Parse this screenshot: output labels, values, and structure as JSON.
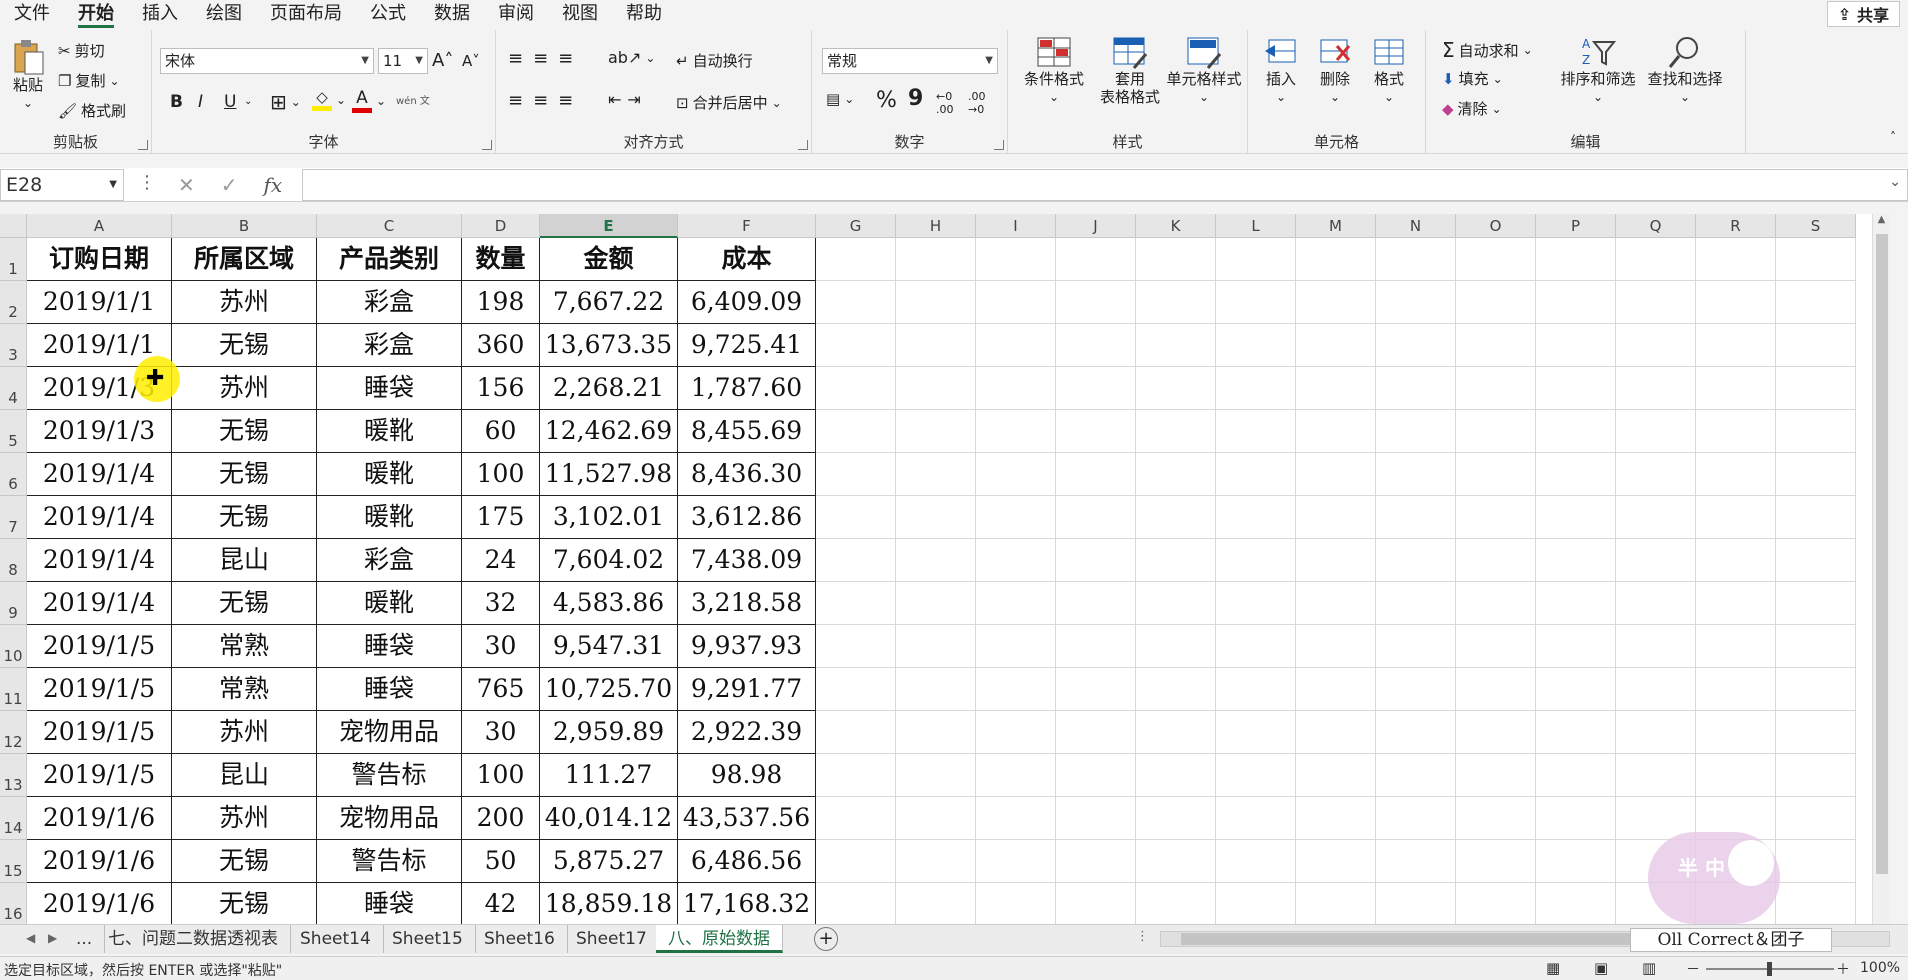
{
  "menu": {
    "items": [
      "文件",
      "开始",
      "插入",
      "绘图",
      "页面布局",
      "公式",
      "数据",
      "审阅",
      "视图",
      "帮助"
    ],
    "active": "开始",
    "share_label": "共享"
  },
  "ribbon": {
    "clipboard": {
      "paste": "粘贴",
      "cut": "剪切",
      "copy": "复制",
      "format_painter": "格式刷",
      "label": "剪贴板"
    },
    "font": {
      "name": "宋体",
      "size": "11",
      "label": "字体",
      "bold": "B",
      "italic": "I",
      "underline": "U",
      "wen": "wén 文"
    },
    "alignment": {
      "wrap": "自动换行",
      "merge": "合并后居中",
      "label": "对齐方式"
    },
    "number": {
      "format": "常规",
      "label": "数字",
      "percent": "%",
      "comma": "9"
    },
    "styles": {
      "conditional": "条件格式",
      "table_1": "套用",
      "table_2": "表格格式",
      "cell_styles": "单元格样式",
      "label": "样式"
    },
    "cells": {
      "insert": "插入",
      "delete": "删除",
      "format": "格式",
      "label": "单元格"
    },
    "editing": {
      "autosum": "自动求和",
      "fill": "填充",
      "clear": "清除",
      "sort": "排序和筛选",
      "find": "查找和选择",
      "label": "编辑"
    }
  },
  "formula_bar": {
    "name_box": "E28",
    "fx": "fx",
    "value": ""
  },
  "grid": {
    "columns": [
      "A",
      "B",
      "C",
      "D",
      "E",
      "F",
      "G",
      "H",
      "I",
      "J",
      "K",
      "L",
      "M",
      "N",
      "O",
      "P",
      "Q",
      "R",
      "S"
    ],
    "selected_column": "E",
    "rows": [
      "1",
      "2",
      "3",
      "4",
      "5",
      "6",
      "7",
      "8",
      "9",
      "10",
      "11",
      "12",
      "13",
      "14",
      "15",
      "16"
    ],
    "header": [
      "订购日期",
      "所属区域",
      "产品类别",
      "数量",
      "金额",
      "成本"
    ],
    "data": [
      [
        "2019/1/1",
        "苏州",
        "彩盒",
        "198",
        "7,667.22",
        "6,409.09"
      ],
      [
        "2019/1/1",
        "无锡",
        "彩盒",
        "360",
        "13,673.35",
        "9,725.41"
      ],
      [
        "2019/1/3",
        "苏州",
        "睡袋",
        "156",
        "2,268.21",
        "1,787.60"
      ],
      [
        "2019/1/3",
        "无锡",
        "暖靴",
        "60",
        "12,462.69",
        "8,455.69"
      ],
      [
        "2019/1/4",
        "无锡",
        "暖靴",
        "100",
        "11,527.98",
        "8,436.30"
      ],
      [
        "2019/1/4",
        "无锡",
        "暖靴",
        "175",
        "3,102.01",
        "3,612.86"
      ],
      [
        "2019/1/4",
        "昆山",
        "彩盒",
        "24",
        "7,604.02",
        "7,438.09"
      ],
      [
        "2019/1/4",
        "无锡",
        "暖靴",
        "32",
        "4,583.86",
        "3,218.58"
      ],
      [
        "2019/1/5",
        "常熟",
        "睡袋",
        "30",
        "9,547.31",
        "9,937.93"
      ],
      [
        "2019/1/5",
        "常熟",
        "睡袋",
        "765",
        "10,725.70",
        "9,291.77"
      ],
      [
        "2019/1/5",
        "苏州",
        "宠物用品",
        "30",
        "2,959.89",
        "2,922.39"
      ],
      [
        "2019/1/5",
        "昆山",
        "警告标",
        "100",
        "111.27",
        "98.98"
      ],
      [
        "2019/1/6",
        "苏州",
        "宠物用品",
        "200",
        "40,014.12",
        "43,537.56"
      ],
      [
        "2019/1/6",
        "无锡",
        "警告标",
        "50",
        "5,875.27",
        "6,486.56"
      ],
      [
        "2019/1/6",
        "无锡",
        "睡袋",
        "42",
        "18,859.18",
        "17,168.32"
      ]
    ]
  },
  "tabs": {
    "items": [
      "...",
      "七、问题二数据透视表",
      "Sheet14",
      "Sheet15",
      "Sheet16",
      "Sheet17",
      "八、原始数据"
    ],
    "active": "八、原始数据",
    "add": "+"
  },
  "watermark": {
    "text": "Oll Correct＆团子",
    "sticker": "半 中"
  },
  "status": {
    "message": "选定目标区域，然后按 ENTER 或选择\"粘贴\"",
    "zoom": "100%"
  },
  "colors": {
    "accent": "#217346",
    "highlight": "#ffee00"
  }
}
